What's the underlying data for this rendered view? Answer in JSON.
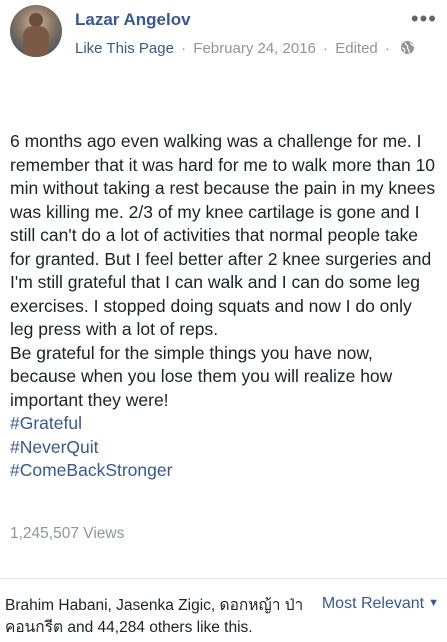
{
  "post": {
    "author": "Lazar Angelov",
    "like_page": "Like This Page",
    "separator": "·",
    "date": "February 24, 2016",
    "edited": "Edited",
    "paragraphs": [
      "6 months ago even walking was a challenge for me. I remember that it was hard for me to walk more than 10 min without taking a rest because the pain in my knees was killing me. 2/3 of my knee cartilage is gone and I still can't do a lot of activities that normal people take for granted. But I feel better after 2 knee surgeries and I'm still grateful that I can walk and I can do some leg exercises. I stopped doing squats and now I do only leg press with a lot of reps.",
      "Be grateful for the simple things you have now, because when you lose them you will realize how important they were!"
    ],
    "hashtags": [
      "#Grateful",
      "#NeverQuit",
      "#ComeBackStronger"
    ],
    "views": "1,245,507 Views"
  },
  "footer": {
    "likes_text": "Brahim Habani, Jasenka Zigic, ดอกหญ้า ป่าคอนกรีต and 44,284 others like this.",
    "sort_label": "Most Relevant"
  },
  "icons": {
    "privacy": "globe-icon",
    "more": "more-options-icon",
    "sort_caret": "caret-down-icon"
  },
  "colors": {
    "link": "#365899",
    "meta": "#90949c",
    "text": "#1d2129"
  }
}
